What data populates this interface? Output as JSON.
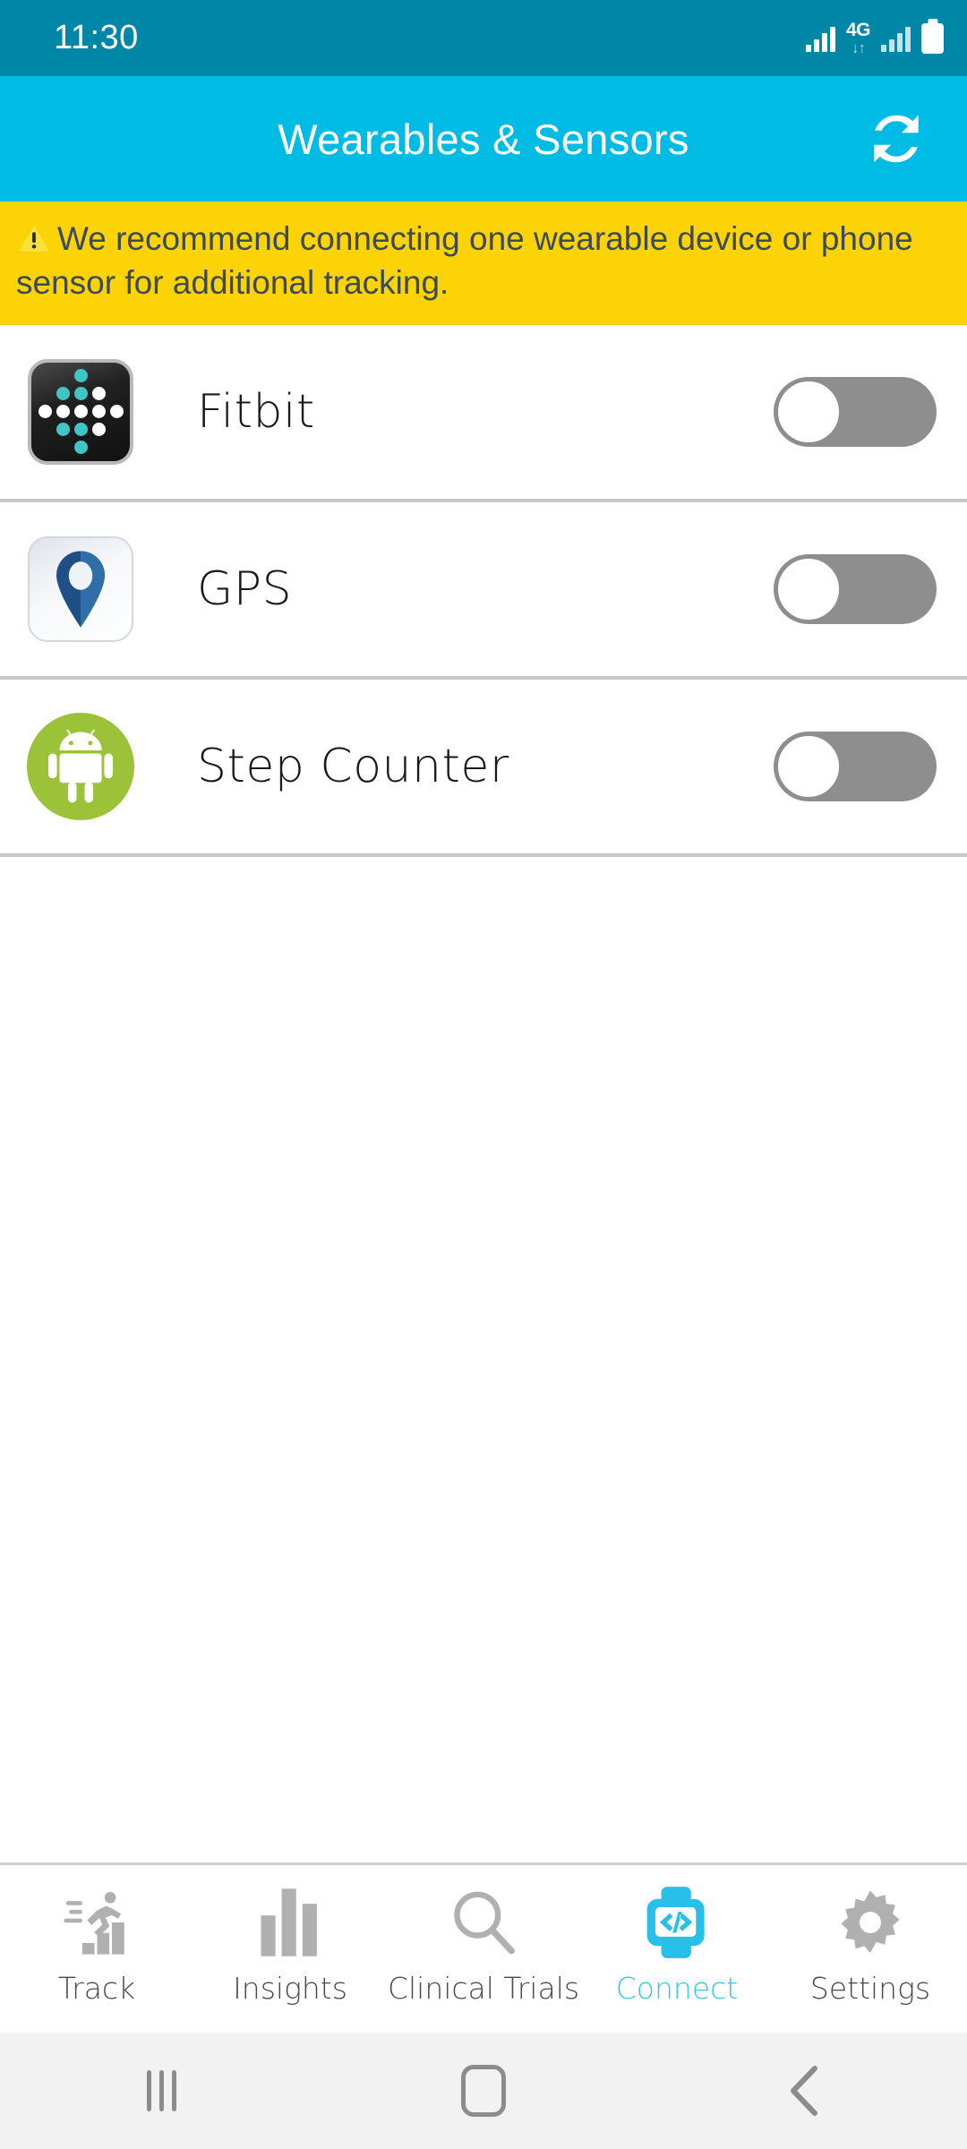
{
  "status_bar": {
    "time": "11:30",
    "network_label": "4G",
    "network_arrows": "↓↑",
    "icons": [
      "signal-bars-icon",
      "network-4g-icon",
      "signal-bars-secondary-icon",
      "battery-icon"
    ]
  },
  "app_bar": {
    "title": "Wearables & Sensors",
    "sync_icon": "sync-refresh-icon"
  },
  "banner": {
    "icon": "warning-triangle-icon",
    "text": "We recommend connecting one wearable device or phone sensor for additional tracking.",
    "background": "#fcd307",
    "text_color": "#3c4a54"
  },
  "devices": [
    {
      "name": "Fitbit",
      "icon": "fitbit-icon",
      "toggle_state": "off"
    },
    {
      "name": "GPS",
      "icon": "gps-pin-icon",
      "toggle_state": "off"
    },
    {
      "name": "Step Counter",
      "icon": "android-robot-icon",
      "toggle_state": "off"
    }
  ],
  "bottom_nav": {
    "active": "Connect",
    "active_color": "#35c6ea",
    "items": [
      {
        "label": "Track",
        "icon": "running-chart-icon"
      },
      {
        "label": "Insights",
        "icon": "bar-chart-icon"
      },
      {
        "label": "Clinical Trials",
        "icon": "magnifier-icon"
      },
      {
        "label": "Connect",
        "icon": "smartwatch-code-icon"
      },
      {
        "label": "Settings",
        "icon": "gear-icon"
      }
    ]
  },
  "system_nav": {
    "items": [
      {
        "name": "recents",
        "icon": "recent-apps-icon"
      },
      {
        "name": "home",
        "icon": "home-icon"
      },
      {
        "name": "back",
        "icon": "back-chevron-icon"
      }
    ]
  },
  "colors": {
    "status_bar": "#0087a8",
    "app_bar": "#00bce4",
    "banner": "#fcd307",
    "toggle_track": "#8e8e8e",
    "android_green": "#9cc23a",
    "fitbit_teal": "#3fc5c5"
  }
}
